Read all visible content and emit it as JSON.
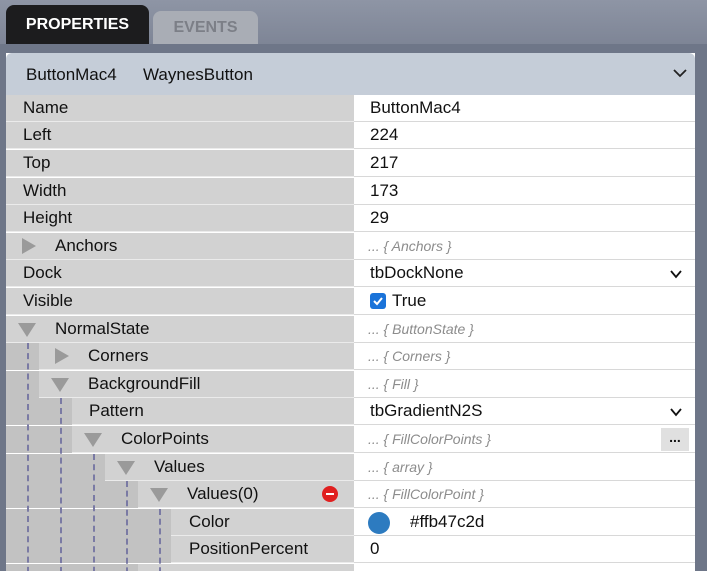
{
  "tabs": [
    {
      "label": "PROPERTIES",
      "active": true
    },
    {
      "label": "EVENTS",
      "active": false
    }
  ],
  "header": {
    "object_name": "ButtonMac4",
    "class_name": "WaynesButton"
  },
  "rows": [
    {
      "name": "Name",
      "value": "ButtonMac4"
    },
    {
      "name": "Left",
      "value": "224"
    },
    {
      "name": "Top",
      "value": "217"
    },
    {
      "name": "Width",
      "value": "173"
    },
    {
      "name": "Height",
      "value": "29"
    },
    {
      "name": "Anchors",
      "value": "... { Anchors }"
    },
    {
      "name": "Dock",
      "value": "tbDockNone"
    },
    {
      "name": "Visible",
      "value": "True"
    },
    {
      "name": "NormalState",
      "value": "... { ButtonState }"
    },
    {
      "name": "Corners",
      "value": "... { Corners }"
    },
    {
      "name": "BackgroundFill",
      "value": "... { Fill }"
    },
    {
      "name": "Pattern",
      "value": "tbGradientN2S"
    },
    {
      "name": "ColorPoints",
      "value": "... { FillColorPoints }"
    },
    {
      "name": "Values",
      "value": "... { array }"
    },
    {
      "name": "Values(0)",
      "value": "... { FillColorPoint }"
    },
    {
      "name": "Color",
      "value": "#ffb47c2d"
    },
    {
      "name": "PositionPercent",
      "value": "0"
    }
  ],
  "ellipsis_button_label": "...",
  "colors": {
    "swatch": "#2d7bc0",
    "checkbox": "#1a73d9",
    "remove": "#e02020"
  },
  "icons": [
    "chevron-down-icon",
    "expand-triangle-icon",
    "collapse-triangle-icon",
    "checkbox-icon",
    "remove-icon",
    "color-swatch-icon"
  ]
}
